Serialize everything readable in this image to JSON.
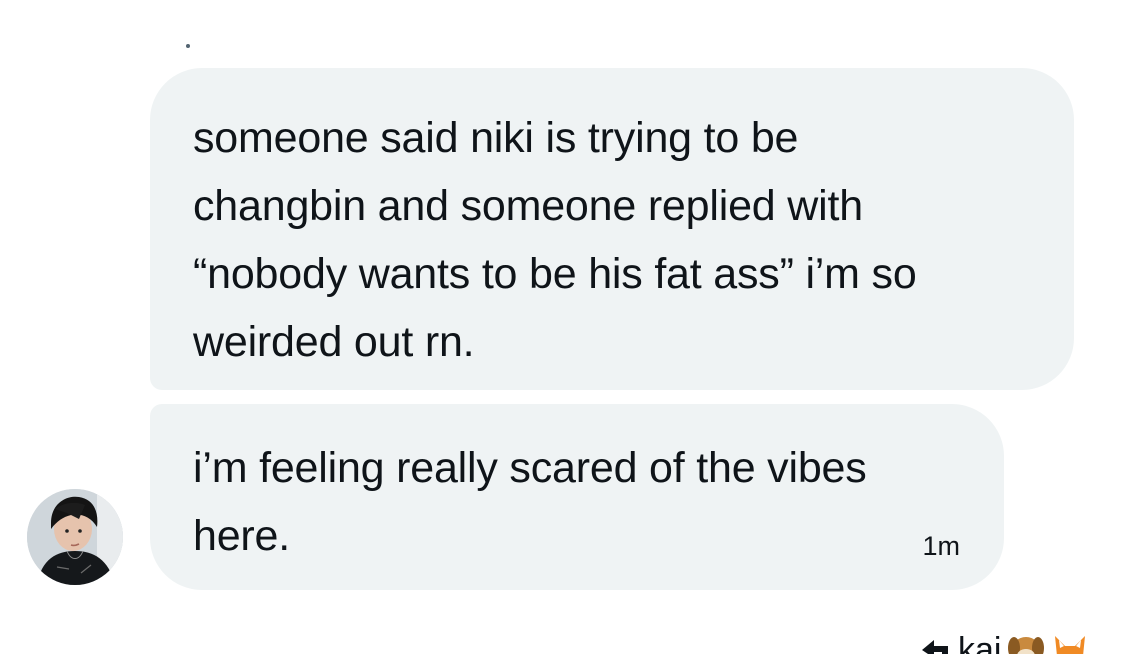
{
  "conversation": {
    "messages": [
      {
        "text": "someone said niki is trying to be\nchangbin and someone replied with\n“nobody wants to be his fat ass” i’m so\nweirded out rn."
      },
      {
        "text": "i’m feeling really scared of the vibes\nhere.",
        "time": "1m"
      }
    ],
    "avatar_icon": "user-avatar",
    "bubble_color": "#eff3f4"
  },
  "footer": {
    "reply_icon": "reply-arrow-icon",
    "name": "kai",
    "emojis": [
      "dog-face-emoji",
      "fox-face-emoji"
    ]
  }
}
